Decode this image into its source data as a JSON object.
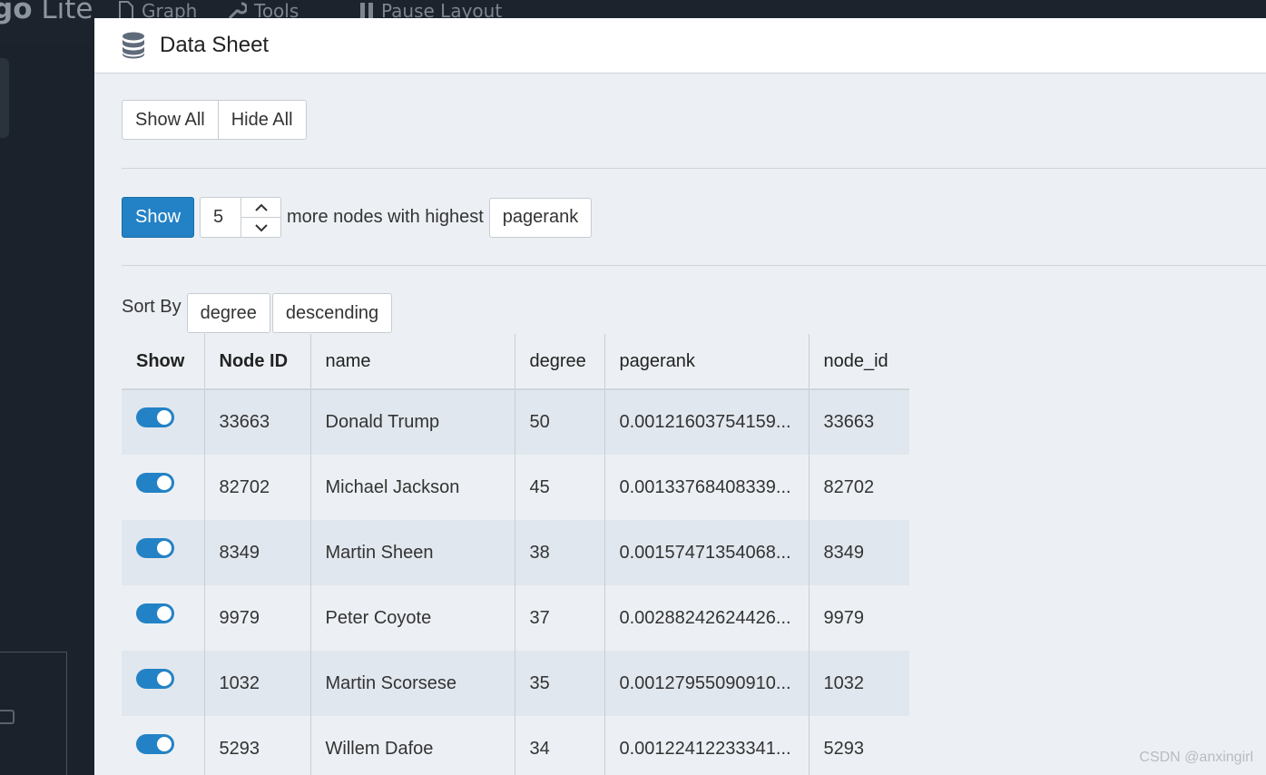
{
  "app": {
    "title_bold": "go",
    "title_light": " Lite",
    "nav": [
      {
        "label": "Graph",
        "icon": "file-icon"
      },
      {
        "label": "Tools",
        "icon": "wrench-icon"
      },
      {
        "label": "Pause Layout",
        "icon": "pause-icon"
      }
    ]
  },
  "modal": {
    "title": "Data Sheet",
    "icon": "database-icon",
    "show_all_label": "Show All",
    "hide_all_label": "Hide All",
    "show_button_label": "Show",
    "show_count": "5",
    "more_text": "more nodes with highest",
    "metric": "pagerank",
    "sort_by_label": "Sort By",
    "sort_field": "degree",
    "sort_order": "descending"
  },
  "table": {
    "headers": [
      "Show",
      "Node ID",
      "name",
      "degree",
      "pagerank",
      "node_id"
    ],
    "rows": [
      {
        "node_id_col": "33663",
        "name": "Donald Trump",
        "degree": "50",
        "pagerank": "0.00121603754159...",
        "node_id": "33663",
        "shown": true
      },
      {
        "node_id_col": "82702",
        "name": "Michael Jackson",
        "degree": "45",
        "pagerank": "0.00133768408339...",
        "node_id": "82702",
        "shown": true
      },
      {
        "node_id_col": "8349",
        "name": "Martin Sheen",
        "degree": "38",
        "pagerank": "0.00157471354068...",
        "node_id": "8349",
        "shown": true
      },
      {
        "node_id_col": "9979",
        "name": "Peter Coyote",
        "degree": "37",
        "pagerank": "0.00288242624426...",
        "node_id": "9979",
        "shown": true
      },
      {
        "node_id_col": "1032",
        "name": "Martin Scorsese",
        "degree": "35",
        "pagerank": "0.00127955090910...",
        "node_id": "1032",
        "shown": true
      },
      {
        "node_id_col": "5293",
        "name": "Willem Dafoe",
        "degree": "34",
        "pagerank": "0.00122412233341...",
        "node_id": "5293",
        "shown": true
      }
    ]
  },
  "colors": {
    "primary": "#2382c6",
    "modal_bg": "#ecf0f4",
    "stripe": "#e1e7ee"
  },
  "watermark": "CSDN @anxingirl"
}
